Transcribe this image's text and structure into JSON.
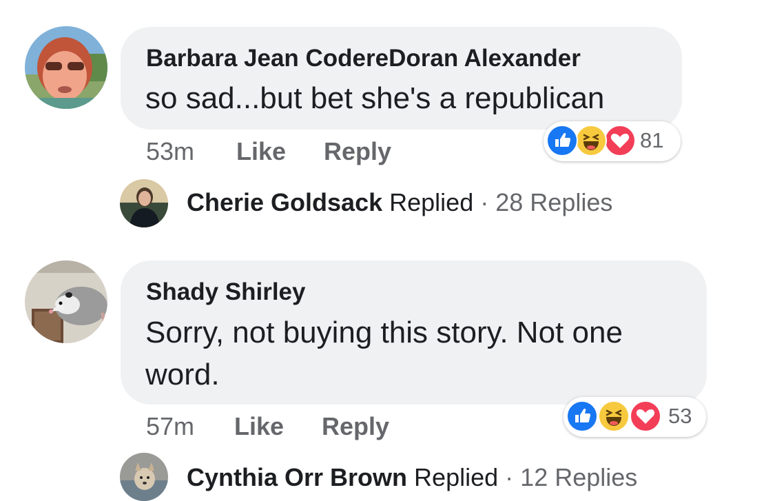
{
  "comments": [
    {
      "author": "Barbara Jean CodereDoran Alexander",
      "text": "so sad...but bet she's a republican",
      "time": "53m",
      "like_label": "Like",
      "reply_label": "Reply",
      "reaction_count": "81",
      "reactions": [
        "like-icon",
        "haha-icon",
        "love-icon"
      ],
      "replied": {
        "name": "Cherie Goldsack",
        "action": "Replied",
        "separator": "·",
        "count": "28 Replies"
      }
    },
    {
      "author": "Shady Shirley",
      "text_line1": "Sorry, not buying this story. Not one",
      "text_line2": "word.",
      "time": "57m",
      "like_label": "Like",
      "reply_label": "Reply",
      "reaction_count": "53",
      "reactions": [
        "like-icon",
        "haha-icon",
        "love-icon"
      ],
      "replied": {
        "name": "Cynthia Orr Brown",
        "action": "Replied",
        "separator": "·",
        "count": "12 Replies"
      }
    }
  ],
  "colors": {
    "bubble": "#f0f1f3",
    "meta_text": "#65676b",
    "like_blue": "#1877f2",
    "haha_yellow": "#f7c93e",
    "love_red": "#f33e58"
  }
}
